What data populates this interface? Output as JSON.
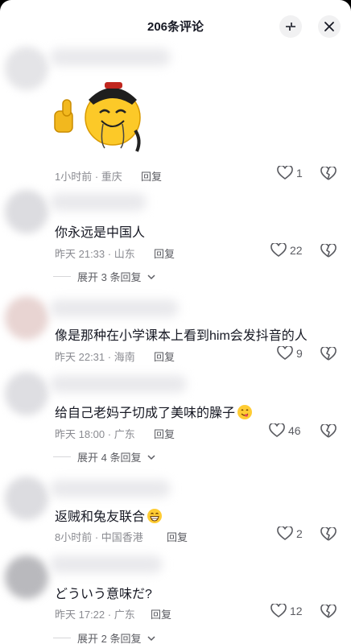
{
  "header": {
    "title": "206条评论"
  },
  "comments": [
    {
      "text": "",
      "time": "1小时前 · 重庆",
      "reply": "回复",
      "likes": "1",
      "has_sticker": true
    },
    {
      "text": "你永远是中国人",
      "time": "昨天 21:33 · 山东",
      "reply": "回复",
      "likes": "22",
      "expand": "展开 3 条回复"
    },
    {
      "text": "像是那种在小学课本上看到him会发抖音的人",
      "time": "昨天 22:31 · 海南",
      "reply": "回复",
      "likes": "9"
    },
    {
      "text": "给自己老妈子切成了美味的臊子",
      "time": "昨天 18:00 · 广东",
      "reply": "回复",
      "likes": "46",
      "expand": "展开 4 条回复"
    },
    {
      "text": "返贼和兔友联合",
      "time": "8小时前 · 中国香港",
      "reply": "回复",
      "likes": "2"
    },
    {
      "text": "どういう意味だ?",
      "time": "昨天 17:22 · 广东",
      "reply": "回复",
      "likes": "12",
      "expand": "展开 2 条回复"
    }
  ],
  "colors": {
    "text": "#161823",
    "meta": "#8a8b91",
    "emoji": "#ffcc33"
  },
  "icons": [
    "collapse-icon",
    "close-icon",
    "heart-icon",
    "broken-heart-icon",
    "chevron-down-icon",
    "thumbs-up-icon",
    "emperor-emoji-icon",
    "yum-emoji-icon",
    "grin-emoji-icon"
  ]
}
